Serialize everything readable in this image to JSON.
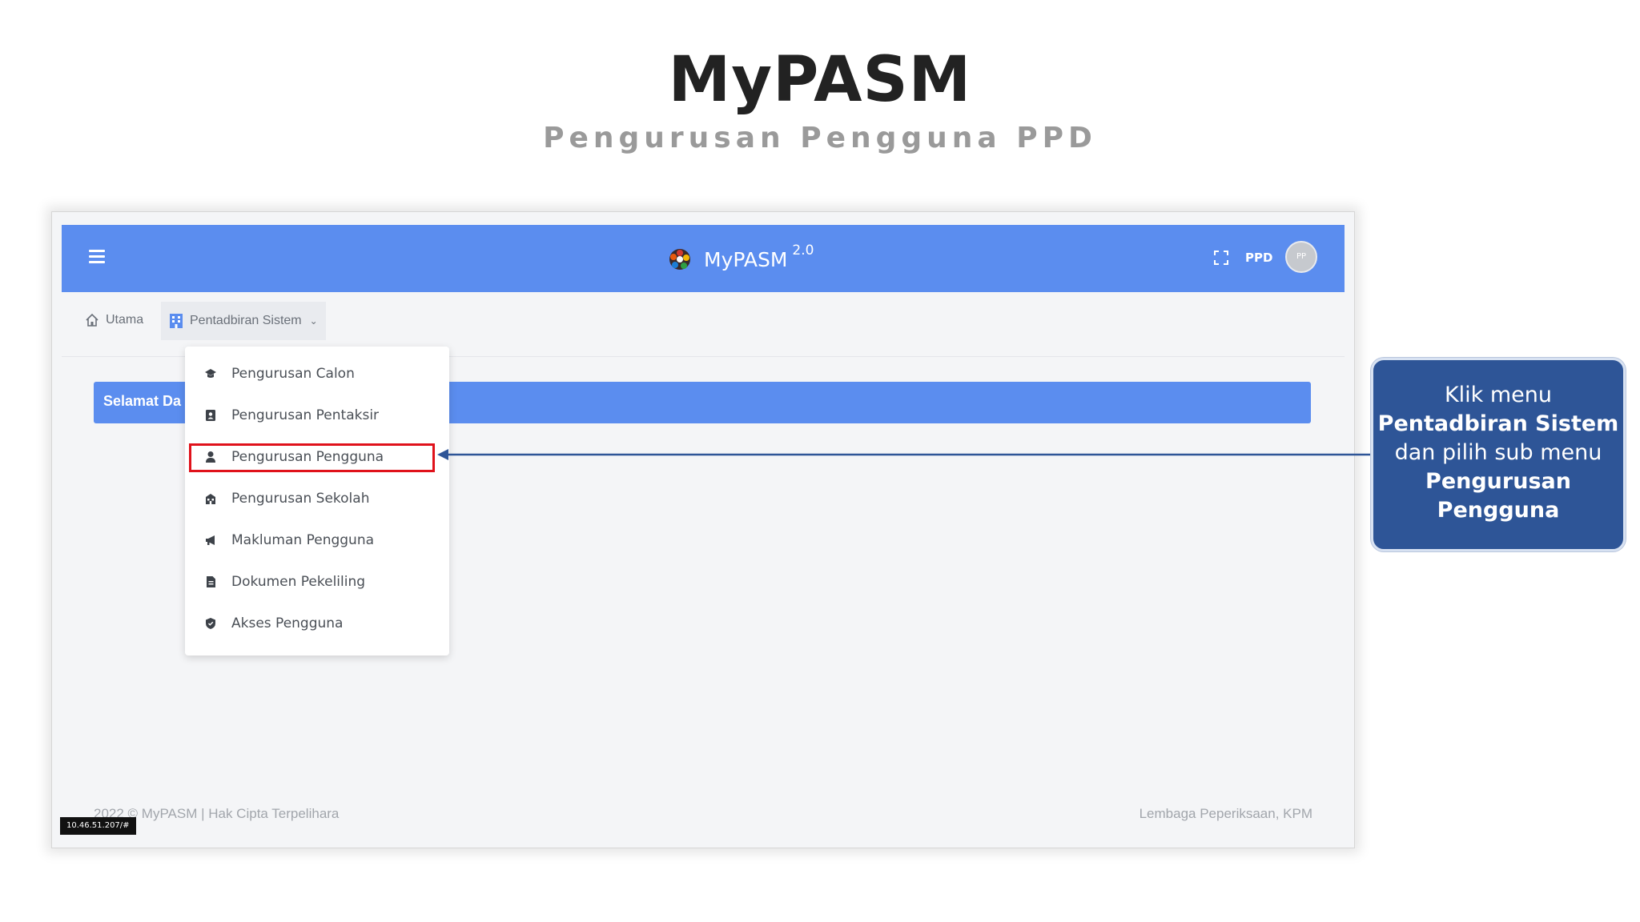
{
  "slide": {
    "title": "MyPASM",
    "subtitle": "Pengurusan Pengguna PPD"
  },
  "app": {
    "brand_name": "MyPASM",
    "brand_version": "2.0",
    "user_code": "PPD",
    "avatar_initials": "PP",
    "colors": {
      "primary": "#5b8def",
      "highlight": "#e0121b",
      "callout": "#2e5597"
    }
  },
  "breadcrumb": {
    "home": "Utama",
    "admin": "Pentadbiran Sistem"
  },
  "welcome": {
    "text": "Selamat Da"
  },
  "menu": {
    "items": [
      {
        "label": "Pengurusan Calon",
        "icon": "graduation-cap-icon"
      },
      {
        "label": "Pengurusan Pentaksir",
        "icon": "id-badge-icon"
      },
      {
        "label": "Pengurusan Pengguna",
        "icon": "user-icon"
      },
      {
        "label": "Pengurusan Sekolah",
        "icon": "school-icon"
      },
      {
        "label": "Makluman Pengguna",
        "icon": "megaphone-icon"
      },
      {
        "label": "Dokumen Pekeliling",
        "icon": "document-icon"
      },
      {
        "label": "Akses Pengguna",
        "icon": "shield-icon"
      }
    ],
    "selected": "Pengurusan Pengguna"
  },
  "footer": {
    "left": "2022 © MyPASM | Hak Cipta Terpelihara",
    "right": "Lembaga Peperiksaan, KPM",
    "url": "10.46.51.207/#"
  },
  "callout": {
    "t1": "Klik menu",
    "b1": "Pentadbiran Sistem",
    "t2": "dan pilih sub menu",
    "b2": "Pengurusan Pengguna"
  }
}
